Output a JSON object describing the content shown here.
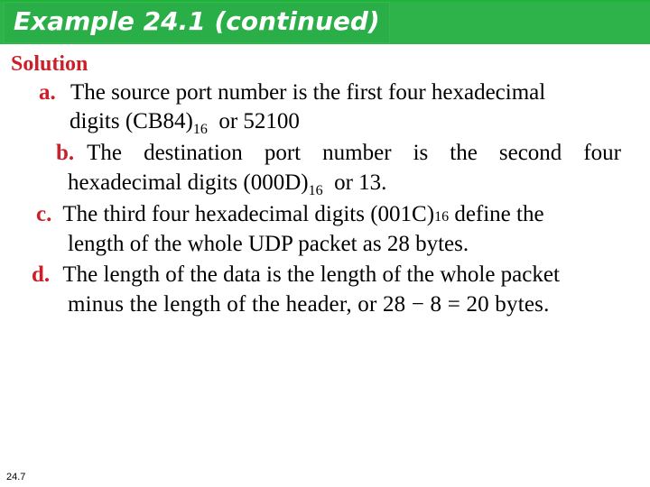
{
  "slide": {
    "title": "Example 24.1 (continued)",
    "heading": "Solution",
    "items": [
      {
        "label": "a.",
        "line1": "The source port number is the first four hexadecimal",
        "line2_pre": "digits (CB84)",
        "line2_sub": "16",
        "line2_post": "  or 52100"
      },
      {
        "label": "b.",
        "line1": "The destination port number is the second four",
        "line2_pre": "hexadecimal digits (000D)",
        "line2_sub": "16",
        "line2_post": "  or 13."
      },
      {
        "label": "c.",
        "line1_pre": "The third four hexadecimal digits (001C)",
        "line1_sub": "16",
        "line1_post": " define the",
        "line2": "length of the whole UDP packet as 28 bytes."
      },
      {
        "label": "d.",
        "line1": "The length of the data is the length of the whole packet",
        "line2": "minus the length of the header, or 28 − 8 = 20 bytes."
      }
    ],
    "page_number": "24.7"
  },
  "colors": {
    "banner": "#2db34a",
    "title_text": "#ffffff",
    "accent_red": "#cc1f2a"
  }
}
